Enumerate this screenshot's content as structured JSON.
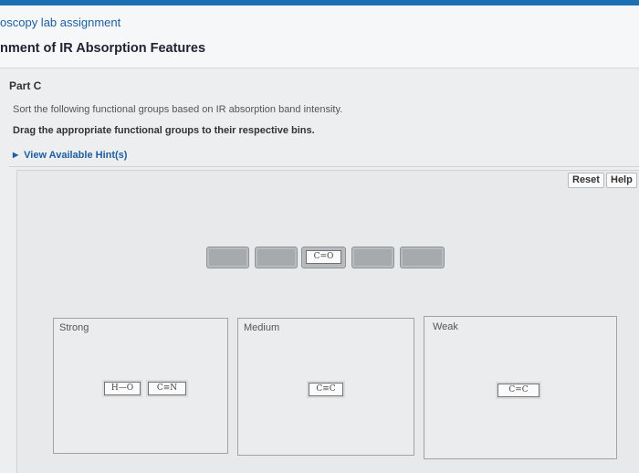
{
  "header": {
    "course": "oscopy lab assignment",
    "assignment": "nment of IR Absorption Features"
  },
  "part_label": "Part C",
  "instruction": "Sort the following functional groups based on IR absorption band intensity.",
  "instruction_bold": "Drag the appropriate functional groups to their respective bins.",
  "hints_link": "View Available Hint(s)",
  "buttons": {
    "reset": "Reset",
    "help": "Help"
  },
  "unsorted_items": [
    {
      "label": ""
    },
    {
      "label": ""
    },
    {
      "label": "C=O"
    },
    {
      "label": ""
    },
    {
      "label": ""
    }
  ],
  "bins": [
    {
      "label": "Strong",
      "items": [
        "H—O",
        "C≡N"
      ]
    },
    {
      "label": "Medium",
      "items": [
        "C≡C"
      ]
    },
    {
      "label": "Weak",
      "items": [
        "C=C"
      ]
    }
  ],
  "colors": {
    "accent": "#1b6fb3",
    "link": "#1d5fa0"
  }
}
